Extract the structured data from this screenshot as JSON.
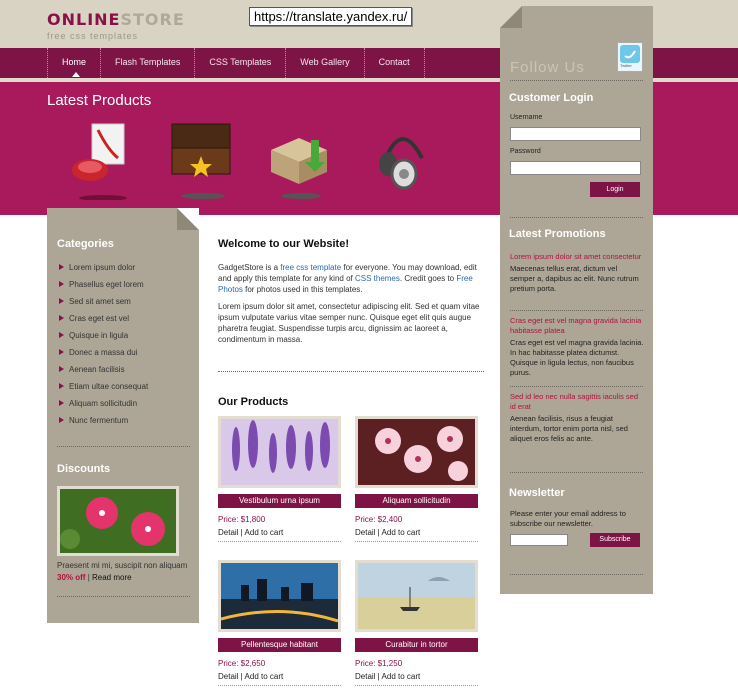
{
  "url_tooltip": "https://translate.yandex.ru/",
  "logo": {
    "part1": "ONLINE",
    "part2": "STORE",
    "tagline": "free css templates"
  },
  "nav": {
    "items": [
      "Home",
      "Flash Templates",
      "CSS Templates",
      "Web Gallery",
      "Contact"
    ]
  },
  "banner": {
    "title": "Latest Products"
  },
  "sidebar_left": {
    "categories_title": "Categories",
    "categories": [
      "Lorem ipsum dolor",
      "Phasellus eget lorem",
      "Sed sit amet sem",
      "Cras eget est vel",
      "Quisque in ligula",
      "Donec a massa dui",
      "Aenean facilisis",
      "Etiam ultae consequat",
      "Aliquam sollicitudin",
      "Nunc fermentum"
    ],
    "discounts_title": "Discounts",
    "discount_text": "Praesent mi mi, suscipit non aliquam",
    "discount_off": "30% off",
    "discount_read": "Read more"
  },
  "main": {
    "welcome_title": "Welcome to our Website!",
    "p1_start": "GadgetStore is a ",
    "p1_link1": "free css template",
    "p1_mid": " for everyone. You may download, edit and apply this template for any kind of ",
    "p1_link2": "CSS themes",
    "p1_mid2": ". Credit goes to ",
    "p1_link3": "Free Photos",
    "p1_end": " for photos used in this templates.",
    "p2": "Lorem ipsum dolor sit amet, consectetur adipiscing elit. Sed et quam vitae ipsum vulputate varius vitae semper nunc. Quisque eget elit quis augue pharetra feugiat. Suspendisse turpis arcu, dignissim ac laoreet a, condimentum in massa.",
    "products_title": "Our Products",
    "products": [
      {
        "name": "Vestibulum urna ipsum",
        "price": "Price: $1,800",
        "detail": "Detail",
        "cart": "Add to cart"
      },
      {
        "name": "Aliquam sollicitudin",
        "price": "Price: $2,400",
        "detail": "Detail",
        "cart": "Add to cart"
      },
      {
        "name": "Pellentesque habitant",
        "price": "Price: $2,650",
        "detail": "Detail",
        "cart": "Add to cart"
      },
      {
        "name": "Curabitur in tortor",
        "price": "Price: $1,250",
        "detail": "Detail",
        "cart": "Add to cart"
      }
    ]
  },
  "sidebar_right": {
    "follow": "Follow Us",
    "twitter": "Twitter",
    "login_title": "Customer Login",
    "username_label": "Username",
    "password_label": "Password",
    "login_button": "Login",
    "promotions_title": "Latest Promotions",
    "promos": [
      {
        "title": "Lorem ipsum dolor sit amet consectetur",
        "text": "Maecenas tellus erat, dictum vel semper a, dapibus ac elit. Nunc rutrum pretium porta."
      },
      {
        "title": "Cras eget est vel magna gravida lacinia habitasse platea",
        "text": "Cras eget est vel magna gravida lacinia. In hac habitasse platea dictumst. Quisque in ligula lectus, non faucibus purus."
      },
      {
        "title": "Sed id leo nec nulla sagittis iaculis sed id erat",
        "text": "Aenean facilisis, risus a feugiat interdum, tortor enim porta nisl, sed aliquet eros felis ac ante."
      }
    ],
    "newsletter_title": "Newsletter",
    "newsletter_text": "Please enter your email address to subscribe our newsletter.",
    "subscribe_button": "Subscribe"
  }
}
